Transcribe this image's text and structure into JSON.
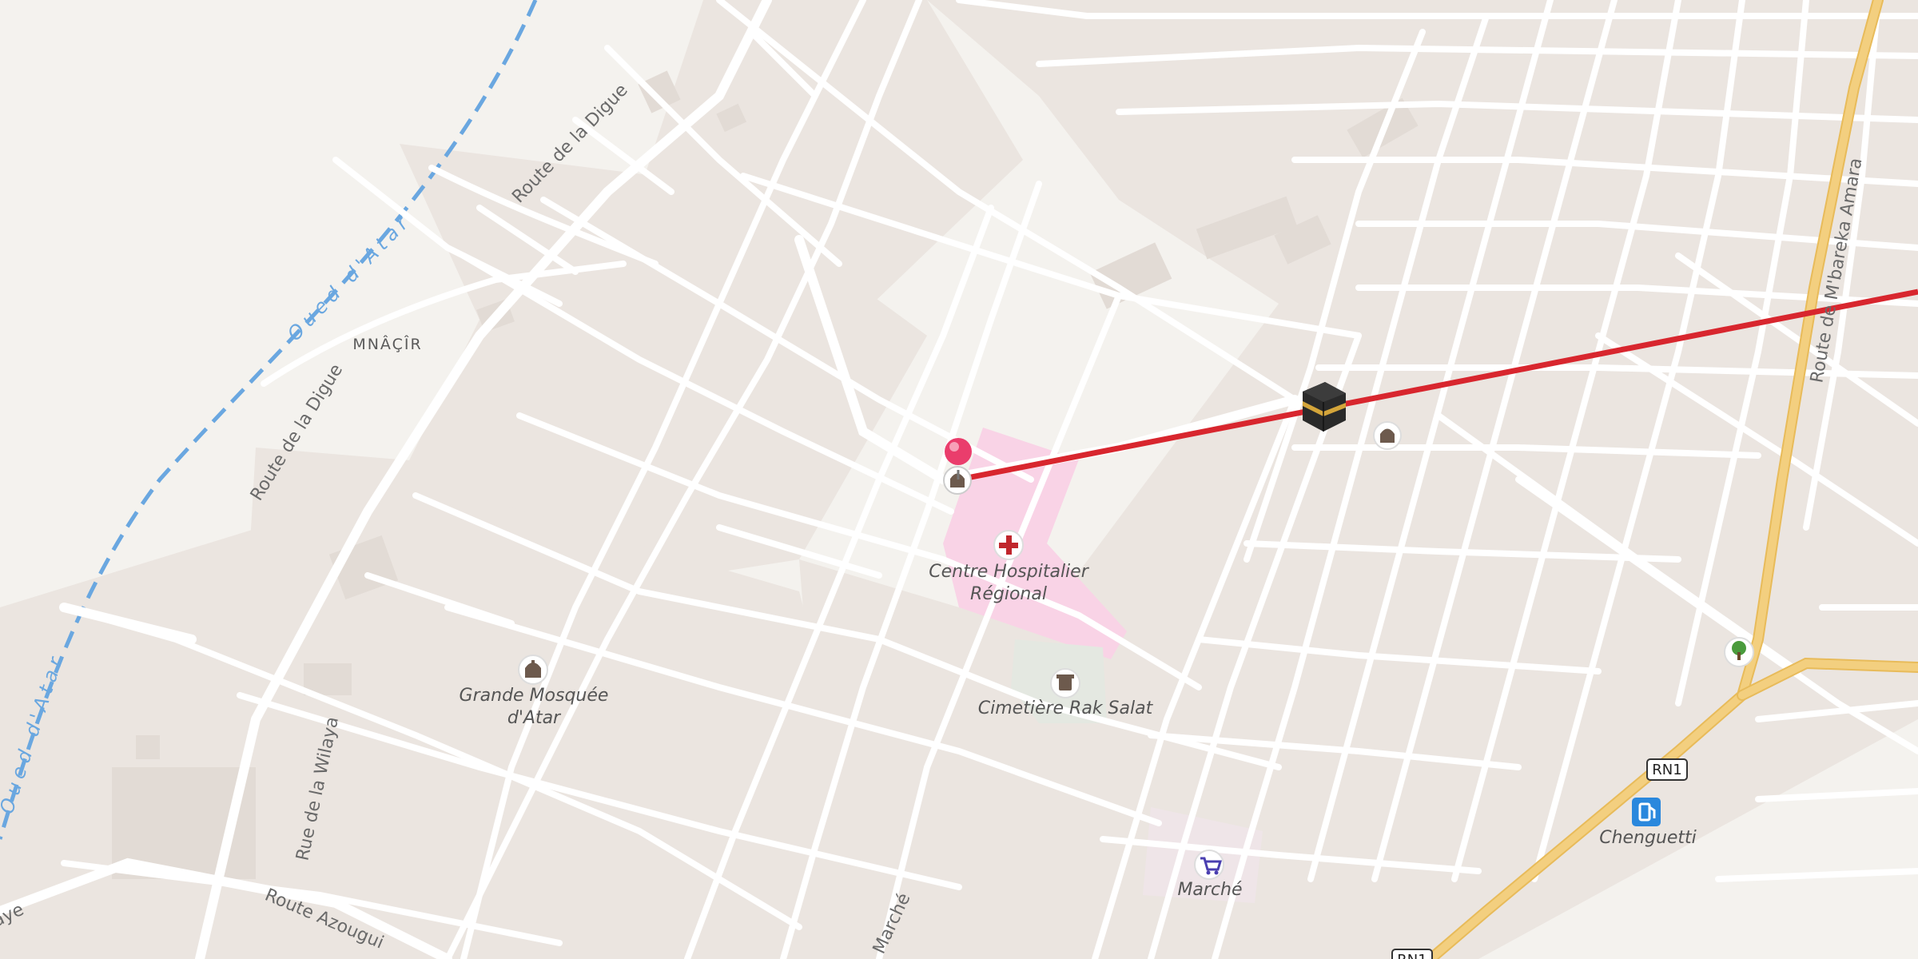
{
  "map": {
    "area_label": "MNÂÇÎR",
    "water_label": "Oued d'Atar",
    "roads": {
      "route_de_la_digue": "Route de la Digue",
      "route_mbareka_amara": "Route de M'bareka Amara",
      "rue_de_la_wilaya": "Rue de la Wilaya",
      "route_azougui": "Route Azougui",
      "marche_street": "Marché",
      "left_edge": "aye",
      "rn1": "RN1"
    },
    "pois": {
      "hospital": "Centre Hospitalier Régional",
      "hospital_line1": "Centre Hospitalier",
      "hospital_line2": "Régional",
      "mosque_line1": "Grande Mosquée",
      "mosque_line2": "d'Atar",
      "cemetery": "Cimetière Rak Salat",
      "market": "Marché",
      "fuel": "Chenguetti"
    },
    "icons": {
      "location_pin": "pin-icon",
      "kaaba": "kaaba-icon",
      "mosque": "mosque-icon",
      "hospital": "hospital-cross-icon",
      "cemetery": "cemetery-icon",
      "market": "shopping-cart-icon",
      "fuel": "fuel-pump-icon",
      "park": "tree-icon"
    },
    "colors": {
      "background": "#f4f2ee",
      "road": "#ffffff",
      "block": "#ece6e1",
      "hospital_area": "#f9d3e6",
      "qibla_line": "#d8262e",
      "primary_road": "#f3cf7f",
      "water": "#6aa7e0",
      "pin": "#ea3d6c"
    }
  }
}
